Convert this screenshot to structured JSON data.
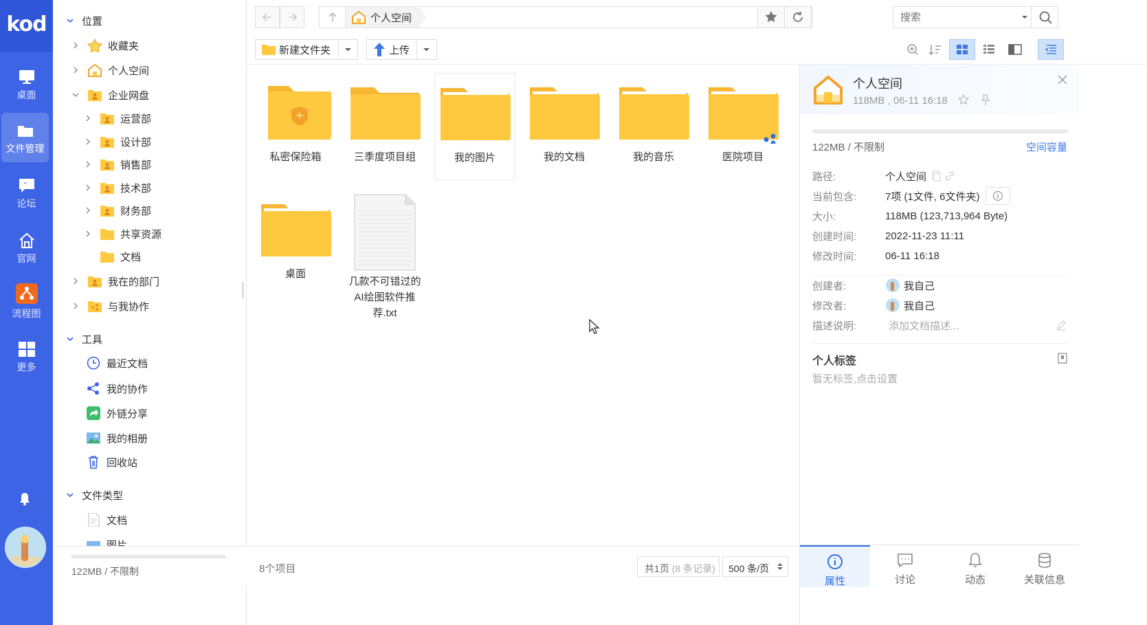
{
  "app": {
    "logo": "kod"
  },
  "rail": {
    "items": [
      {
        "label": "桌面",
        "icon": "monitor-icon"
      },
      {
        "label": "文件管理",
        "icon": "folder-icon"
      },
      {
        "label": "论坛",
        "icon": "chat-icon"
      },
      {
        "label": "官网",
        "icon": "home-icon"
      },
      {
        "label": "流程图",
        "icon": "flowchart-icon"
      },
      {
        "label": "更多",
        "icon": "grid-icon"
      }
    ],
    "active": "文件管理"
  },
  "tree": {
    "location_label": "位置",
    "favorites": "收藏夹",
    "personal_space": "个人空间",
    "enterprise_disk": "企业网盘",
    "departments": [
      "运营部",
      "设计部",
      "销售部",
      "技术部",
      "财务部",
      "共享资源",
      "文档"
    ],
    "my_department": "我在的部门",
    "collaborate_with_me": "与我协作",
    "tools_label": "工具",
    "tools": [
      "最近文档",
      "我的协作",
      "外链分享",
      "我的相册",
      "回收站"
    ],
    "file_types_label": "文件类型",
    "file_types": [
      "文档",
      "图片"
    ],
    "quota": "122MB / 不限制"
  },
  "topbar": {
    "breadcrumb": "个人空间",
    "search_placeholder": "搜索"
  },
  "toolbar": {
    "new_folder": "新建文件夹",
    "upload": "上传",
    "view_mode": "icon"
  },
  "files": [
    {
      "name": "私密保险箱",
      "type": "safe-folder"
    },
    {
      "name": "三季度项目组",
      "type": "folder"
    },
    {
      "name": "我的图片",
      "type": "folder"
    },
    {
      "name": "我的文档",
      "type": "folder"
    },
    {
      "name": "我的音乐",
      "type": "folder"
    },
    {
      "name": "医院项目",
      "type": "shared-folder"
    },
    {
      "name": "桌面",
      "type": "folder"
    },
    {
      "name": "几款不可错过的AI绘图软件推荐.txt",
      "type": "txt",
      "name_lines": [
        "几款不可错过的",
        "AI绘图软件推",
        "荐.txt"
      ]
    }
  ],
  "status": {
    "count": "8个项目",
    "pages": "共1页",
    "records": "(8 条记录)",
    "per_page": "500 条/页"
  },
  "panel": {
    "title": "个人空间",
    "subtitle": "118MB , 06-11 16:18",
    "quota": "122MB / 不限制",
    "capacity_link": "空间容量",
    "props": [
      {
        "key": "路径:",
        "value": "个人空间"
      },
      {
        "key": "当前包含:",
        "value": "7项 (1文件, 6文件夹)"
      },
      {
        "key": "大小:",
        "value": "118MB (123,713,964 Byte)"
      },
      {
        "key": "创建时间:",
        "value": "2022-11-23 11:11"
      },
      {
        "key": "修改时间:",
        "value": "06-11 16:18"
      }
    ],
    "creator_label": "创建者:",
    "creator": "我自己",
    "modifier_label": "修改者:",
    "modifier": "我自己",
    "desc_label": "描述说明:",
    "desc_placeholder": "添加文档描述...",
    "tags_title": "个人标签",
    "tags_empty": "暂无标签,点击设置",
    "tabs": [
      "属性",
      "讨论",
      "动态",
      "关联信息"
    ],
    "active_tab": "属性"
  },
  "colors": {
    "rail": "#3e64e6",
    "accent": "#2f6fe0",
    "folder": "#ffc93f"
  }
}
